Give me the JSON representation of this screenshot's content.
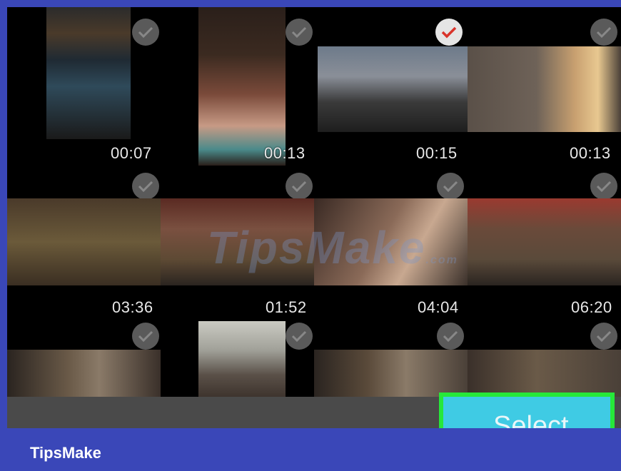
{
  "gallery": {
    "rows": [
      {
        "durations": [
          "00:07",
          "00:13",
          "00:15",
          "00:13"
        ],
        "checked": [
          false,
          false,
          true,
          false
        ]
      },
      {
        "durations": [
          "03:36",
          "01:52",
          "04:04",
          "06:20"
        ],
        "checked": [
          false,
          false,
          false,
          false
        ]
      },
      {
        "durations": [
          "",
          "",
          "",
          ""
        ],
        "checked": [
          false,
          false,
          false,
          false
        ]
      }
    ]
  },
  "action": {
    "select_label": "Select"
  },
  "watermark": {
    "text": "TipsMake",
    "suffix": ".com"
  },
  "footer": {
    "brand": "TipsMake"
  },
  "colors": {
    "frame": "#3a47b8",
    "select_button": "#3fcbe4",
    "highlight": "#26e83a",
    "check_on": "#d9342b"
  }
}
